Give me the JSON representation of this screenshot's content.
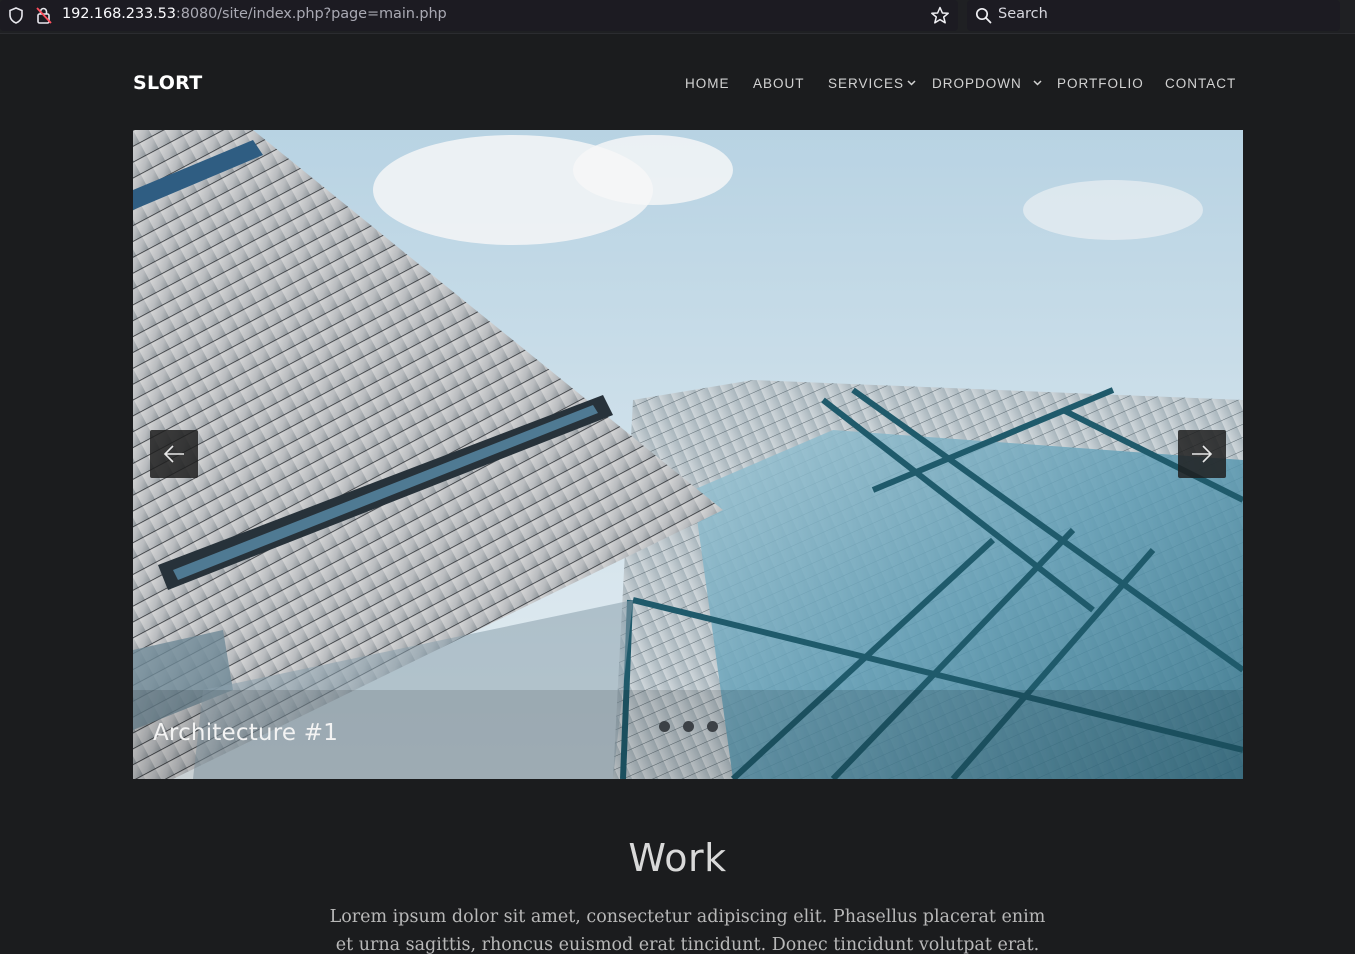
{
  "browser": {
    "url_host": "192.168.233.53",
    "url_rest": ":8080/site/index.php?page=main.php",
    "search_placeholder": "Search"
  },
  "site": {
    "logo": "SLORT",
    "nav": {
      "home": "HOME",
      "about": "ABOUT",
      "services": "SERVICES",
      "dropdown": "DROPDOWN",
      "portfolio": "PORTFOLIO",
      "contact": "CONTACT"
    }
  },
  "slider": {
    "caption": "Architecture #1",
    "slide_count": 3,
    "active_slide": 1,
    "prev_icon": "arrow-left-icon",
    "next_icon": "arrow-right-icon"
  },
  "work": {
    "title": "Work",
    "text": "Lorem ipsum dolor sit amet, consectetur adipiscing elit. Phasellus placerat enim et urna sagittis, rhoncus euismod erat tincidunt. Donec tincidunt volutpat erat."
  },
  "colors": {
    "page_bg": "#1b1c1e",
    "text_light": "#d2d2d2",
    "logo": "#ffffff"
  }
}
